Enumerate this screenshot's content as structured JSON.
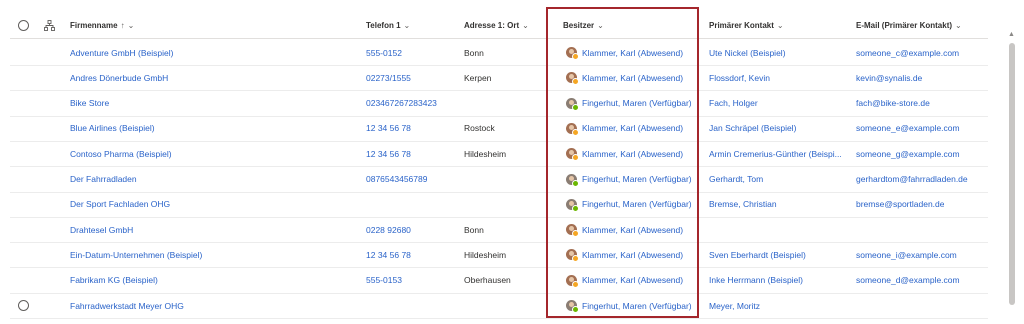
{
  "columns": {
    "company": "Firmenname",
    "phone": "Telefon 1",
    "city": "Adresse 1: Ort",
    "owner": "Besitzer",
    "contact": "Primärer Kontakt",
    "email": "E-Mail (Primärer Kontakt)"
  },
  "sort_arrow": "↑",
  "chevron": "⌄",
  "rows": [
    {
      "company": "Adventure GmbH (Beispiel)",
      "phone": "555-0152",
      "city": "Bonn",
      "owner": "Klammer, Karl (Abwesend)",
      "owner_status": "away",
      "contact": "Ute Nickel (Beispiel)",
      "email": "someone_c@example.com"
    },
    {
      "company": "Andres Dönerbude GmbH",
      "phone": "02273/1555",
      "city": "Kerpen",
      "owner": "Klammer, Karl (Abwesend)",
      "owner_status": "away",
      "contact": "Flossdorf, Kevin",
      "email": "kevin@synalis.de"
    },
    {
      "company": "Bike Store",
      "phone": "023467267283423",
      "city": "",
      "owner": "Fingerhut, Maren (Verfügbar)",
      "owner_status": "available",
      "contact": "Fach, Holger",
      "email": "fach@bike-store.de"
    },
    {
      "company": "Blue Airlines (Beispiel)",
      "phone": "12 34 56 78",
      "city": "Rostock",
      "owner": "Klammer, Karl (Abwesend)",
      "owner_status": "away",
      "contact": "Jan Schräpel (Beispiel)",
      "email": "someone_e@example.com"
    },
    {
      "company": "Contoso Pharma (Beispiel)",
      "phone": "12 34 56 78",
      "city": "Hildesheim",
      "owner": "Klammer, Karl (Abwesend)",
      "owner_status": "away",
      "contact": "Armin Cremerius-Günther (Beispi...",
      "email": "someone_g@example.com"
    },
    {
      "company": "Der Fahrradladen",
      "phone": "0876543456789",
      "city": "",
      "owner": "Fingerhut, Maren (Verfügbar)",
      "owner_status": "available",
      "contact": "Gerhardt, Tom",
      "email": "gerhardtom@fahrradladen.de"
    },
    {
      "company": "Der Sport Fachladen OHG",
      "phone": "",
      "city": "",
      "owner": "Fingerhut, Maren (Verfügbar)",
      "owner_status": "available",
      "contact": "Bremse, Christian",
      "email": "bremse@sportladen.de"
    },
    {
      "company": "Drahtesel GmbH",
      "phone": "0228 92680",
      "city": "Bonn",
      "owner": "Klammer, Karl (Abwesend)",
      "owner_status": "away",
      "contact": "",
      "email": ""
    },
    {
      "company": "Ein-Datum-Unternehmen (Beispiel)",
      "phone": "12 34 56 78",
      "city": "Hildesheim",
      "owner": "Klammer, Karl (Abwesend)",
      "owner_status": "away",
      "contact": "Sven Eberhardt (Beispiel)",
      "email": "someone_i@example.com"
    },
    {
      "company": "Fabrikam KG (Beispiel)",
      "phone": "555-0153",
      "city": "Oberhausen",
      "owner": "Klammer, Karl (Abwesend)",
      "owner_status": "away",
      "contact": "Inke Herrmann (Beispiel)",
      "email": "someone_d@example.com"
    },
    {
      "company": "Fahrradwerkstadt Meyer OHG",
      "phone": "",
      "city": "",
      "owner": "Fingerhut, Maren (Verfügbar)",
      "owner_status": "available",
      "contact": "Meyer, Moritz",
      "email": ""
    }
  ],
  "colors": {
    "link": "#2a63c9",
    "highlight": "#a4262c",
    "away": "#f5a623",
    "available": "#6bb700"
  }
}
